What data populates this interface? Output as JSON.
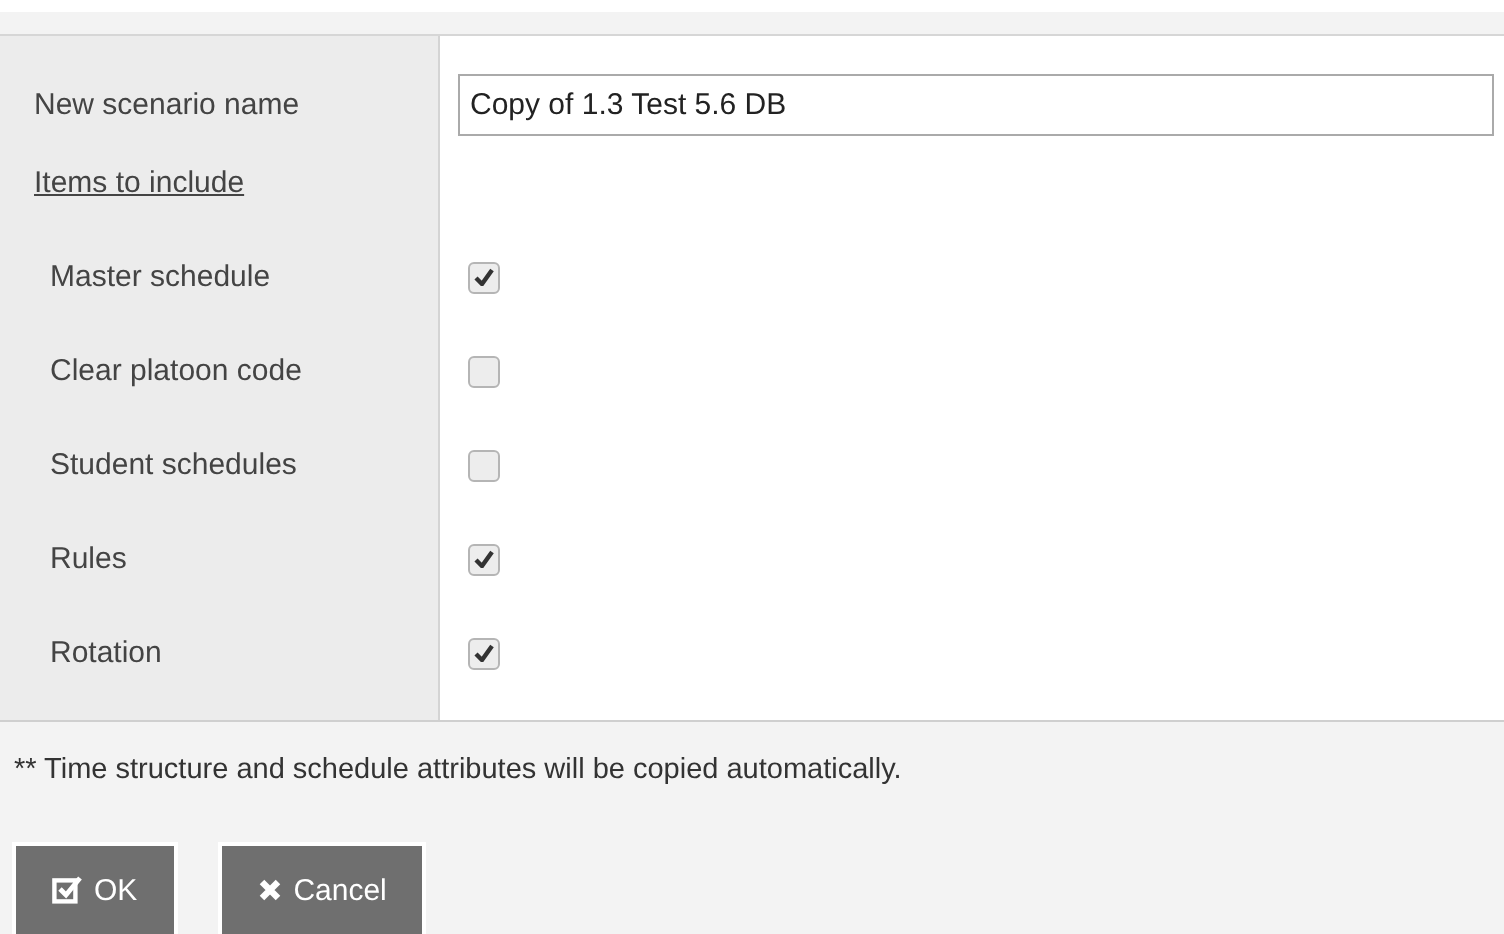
{
  "scenario_name": {
    "label": "New scenario name",
    "value": "Copy of 1.3 Test 5.6 DB"
  },
  "items_heading": "Items to include",
  "items": [
    {
      "label": "Master schedule",
      "checked": true
    },
    {
      "label": "Clear platoon code",
      "checked": false
    },
    {
      "label": "Student schedules",
      "checked": false
    },
    {
      "label": "Rules",
      "checked": true
    },
    {
      "label": "Rotation",
      "checked": true
    }
  ],
  "note": "** Time structure and schedule attributes will be copied automatically.",
  "buttons": [
    {
      "kind": "ok",
      "label": "OK"
    },
    {
      "kind": "cancel",
      "label": "Cancel"
    }
  ]
}
